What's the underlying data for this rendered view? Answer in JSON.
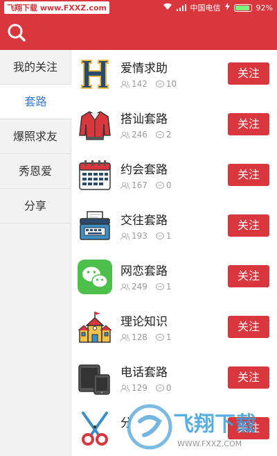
{
  "status_bar": {
    "watermark": "飞翔下载 www.FXXZ.com",
    "carrier": "中国电信",
    "battery_percent": "92%",
    "battery_level": 0.92
  },
  "header": {
    "search_icon": "search-icon"
  },
  "sidebar": {
    "items": [
      {
        "label": "我的关注"
      },
      {
        "label": "套路"
      },
      {
        "label": "爆照求友"
      },
      {
        "label": "秀恩爱"
      },
      {
        "label": "分享"
      }
    ],
    "active_index": 1
  },
  "list": {
    "items": [
      {
        "title": "爱情求助",
        "members": "142",
        "posts": "10",
        "button": "关注",
        "icon": "letter-h-icon"
      },
      {
        "title": "搭讪套路",
        "members": "246",
        "posts": "2",
        "button": "关注",
        "icon": "jacket-icon"
      },
      {
        "title": "约会套路",
        "members": "167",
        "posts": "0",
        "button": "关注",
        "icon": "calendar-icon"
      },
      {
        "title": "交往套路",
        "members": "193",
        "posts": "1",
        "button": "关注",
        "icon": "typewriter-icon"
      },
      {
        "title": "网恋套路",
        "members": "249",
        "posts": "1",
        "button": "关注",
        "icon": "wechat-icon"
      },
      {
        "title": "理论知识",
        "members": "128",
        "posts": "1",
        "button": "关注",
        "icon": "school-icon"
      },
      {
        "title": "电话套路",
        "members": "129",
        "posts": "0",
        "button": "关注",
        "icon": "devices-icon"
      },
      {
        "title": "分",
        "members": "",
        "posts": "",
        "button": "关注",
        "icon": "scissors-icon"
      }
    ]
  },
  "watermark": {
    "text": "飞翔下载",
    "url": "WWW.FXXZ.COM"
  },
  "colors": {
    "brand_red": "#d9363e",
    "active_blue": "#3a7bd5"
  }
}
